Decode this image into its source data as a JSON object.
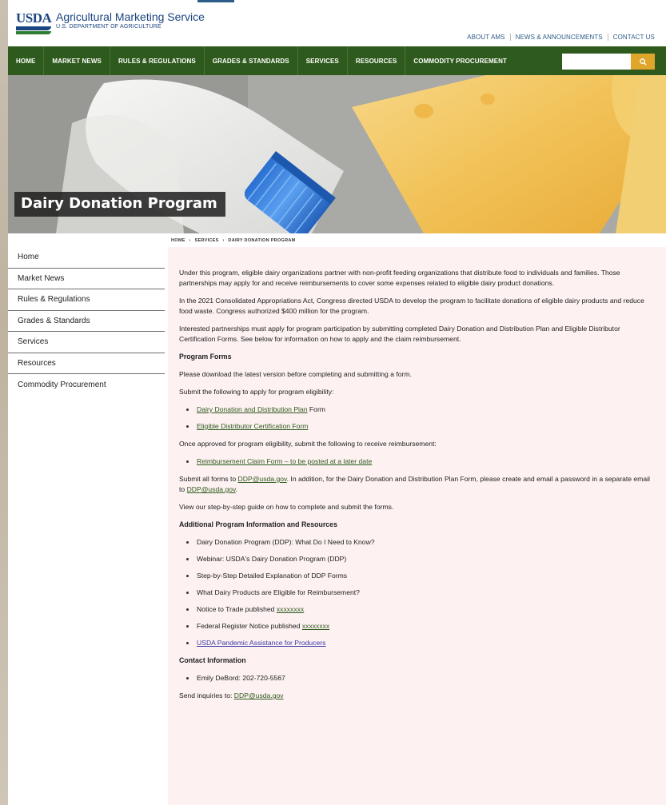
{
  "header": {
    "logo_text": "USDA",
    "agency_name": "Agricultural Marketing Service",
    "department": "U.S. DEPARTMENT OF AGRICULTURE",
    "utility_nav": [
      "ABOUT AMS",
      "NEWS & ANNOUNCEMENTS",
      "CONTACT US"
    ]
  },
  "main_nav": {
    "items": [
      "HOME",
      "MARKET NEWS",
      "RULES & REGULATIONS",
      "GRADES & STANDARDS",
      "SERVICES",
      "RESOURCES",
      "COMMODITY PROCUREMENT"
    ],
    "search_placeholder": "",
    "search_icon": "search-icon",
    "accent_color": "#e0a52b",
    "nav_color": "#2f5a1d"
  },
  "hero": {
    "title": "Dairy Donation Program"
  },
  "breadcrumb": [
    "HOME",
    "›",
    "SERVICES",
    "›",
    "DAIRY DONATION PROGRAM"
  ],
  "sidebar": {
    "items": [
      "Home",
      "Market News",
      "Rules & Regulations",
      "Grades & Standards",
      "Services",
      "Resources",
      "Commodity Procurement"
    ]
  },
  "content": {
    "p1": "Under this program, eligible dairy organizations partner with non-profit feeding organizations that distribute food to individuals and families. Those partnerships may apply for and receive reimbursements to cover some expenses related to eligible dairy product donations.",
    "p2": "In the 2021 Consolidated Appropriations Act, Congress directed USDA to develop the program to facilitate donations of eligible dairy products and reduce food waste. Congress authorized $400 million for the program.",
    "p3": "Interested partnerships must apply for program participation by submitting completed Dairy Donation and Distribution Plan and Eligible Distributor Certification Forms. See below for information on how to apply and the claim reimbursement.",
    "forms_heading": "Program Forms",
    "forms_p1": "Please download the latest version before completing and submitting a form.",
    "forms_p2": "Submit the following to apply for program eligibility:",
    "eligibility_link1": "Dairy Donation and Distribution Plan",
    "eligibility_link1_suffix": " Form",
    "eligibility_link2": "Eligible Distributor Certification Form",
    "forms_p3": "Once approved for program eligibility, submit the following to receive reimbursement:",
    "reimbursement_link": "Reimbursement Claim Form – to be posted at a later date",
    "submit_prefix": "Submit all forms to ",
    "submit_email1": "DDP@usda.gov",
    "submit_middle": ". In addition, for the Dairy Donation and Distribution Plan Form, please create and email a password in a separate email to ",
    "submit_email2": "DDP@usda.gov",
    "submit_suffix": ".",
    "guide_text": "View our step-by-step guide on how to complete and submit the forms.",
    "additional_heading": "Additional Program Information and Resources",
    "additional_items": [
      "Dairy Donation Program (DDP): What Do I Need to Know?",
      "Webinar: USDA's Dairy Donation Program (DDP)",
      "Step-by-Step Detailed Explanation of DDP Forms",
      "What Dairy Products are Eligible for Reimbursement?"
    ],
    "notice_trade_prefix": "Notice to Trade published ",
    "notice_trade_link": "xxxxxxxx",
    "federal_notice_prefix": "Federal Register Notice published ",
    "federal_notice_link": "xxxxxxxx",
    "pandemic_link": "USDA Pandemic Assistance for Producers",
    "contact_heading": "Contact Information",
    "contact_item": "Emily DeBord: 202-720-5567",
    "inquiries_prefix": "Send inquiries to: ",
    "inquiries_email": "DDP@usda.gov"
  }
}
